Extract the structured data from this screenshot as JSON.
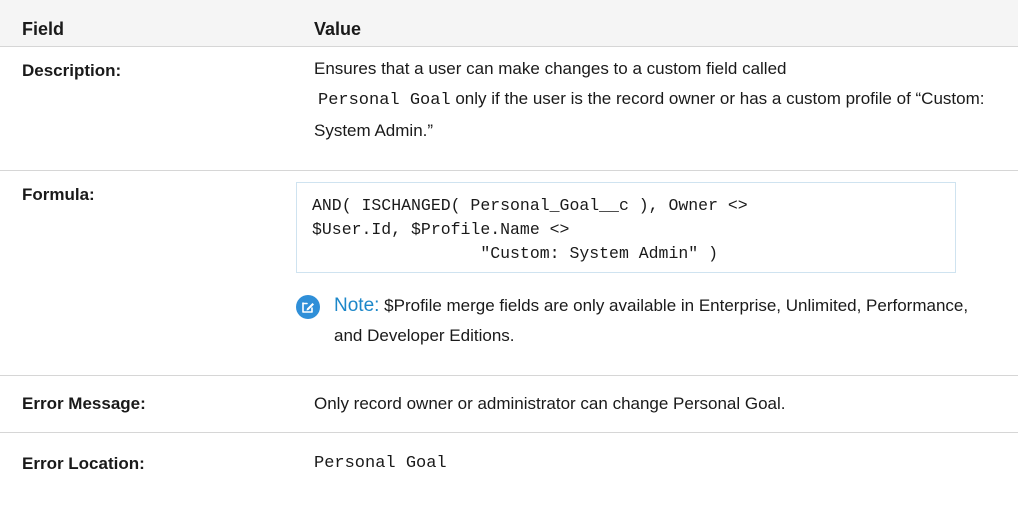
{
  "header": {
    "field": "Field",
    "value": "Value"
  },
  "rows": {
    "description": {
      "label": "Description:",
      "text_before": "Ensures that a user can make changes to a custom field called",
      "code": "Personal Goal",
      "text_after": " only if the user is the record owner or has a custom profile of “Custom: System Admin.”"
    },
    "formula": {
      "label": "Formula:",
      "code": "AND( ISCHANGED( Personal_Goal__c ), Owner <>\n$User.Id, $Profile.Name <>\n                 \"Custom: System Admin\" )",
      "note_label": "Note:",
      "note_text": "$Profile merge fields are only available in Enterprise, Unlimited, Performance, and Developer Editions.",
      "note_icon": "edit-note-icon",
      "note_icon_color": "#2f8fd8",
      "note_label_color": "#1c87c9"
    },
    "error_message": {
      "label": "Error Message:",
      "text": "Only record owner or administrator can change Personal Goal."
    },
    "error_location": {
      "label": "Error Location:",
      "code": "Personal Goal"
    }
  }
}
